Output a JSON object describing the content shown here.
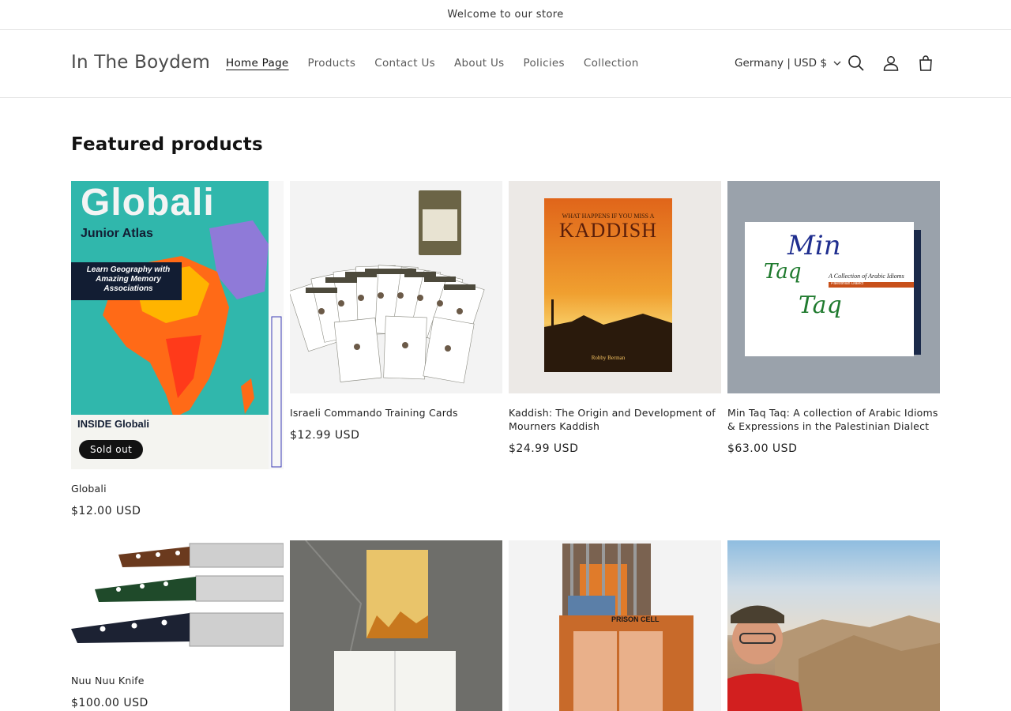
{
  "announcement": "Welcome to our store",
  "header": {
    "logo": "In The Boydem",
    "nav": [
      "Home Page",
      "Products",
      "Contact Us",
      "About Us",
      "Policies",
      "Collection"
    ],
    "locale": "Germany | USD $",
    "icons": [
      "search-icon",
      "account-icon",
      "cart-icon"
    ]
  },
  "featured": {
    "title": "Featured products",
    "products": [
      {
        "title": "Globali",
        "price": "$12.00 USD",
        "badge": "Sold out",
        "cover_title": "Globali",
        "cover_subtitle": "Junior Atlas",
        "cover_text": "Learn Geography with Amazing Memory Associations",
        "cover_bottom": "INSIDE Globali"
      },
      {
        "title": "Israeli Commando Training Cards",
        "price": "$12.99 USD"
      },
      {
        "title": "Kaddish: The Origin and Development of Mourners Kaddish",
        "price": "$24.99 USD",
        "cover_top": "WHAT HAPPENS IF YOU MISS A",
        "cover_title": "KADDISH",
        "cover_author": "Robby Berman"
      },
      {
        "title": "Min Taq Taq: A collection of Arabic Idioms & Expressions in the Palestinian Dialect",
        "price": "$63.00 USD",
        "cover_title_1": "Min",
        "cover_title_2": "Taq",
        "cover_title_3": "Taq",
        "cover_subtitle": "A Collection of Arabic Idioms",
        "cover_band": "Palestinian Dialect"
      },
      {
        "title": "Nuu Nuu Knife",
        "price": "$100.00 USD"
      },
      {
        "title": "",
        "price": ""
      },
      {
        "title": "",
        "price": "",
        "cover_text": "PRISON CELL"
      },
      {
        "title": "",
        "price": ""
      }
    ]
  },
  "colors": {
    "accent": "#121212",
    "border": "#e6e6e6",
    "muted": "#5b5b5b"
  }
}
